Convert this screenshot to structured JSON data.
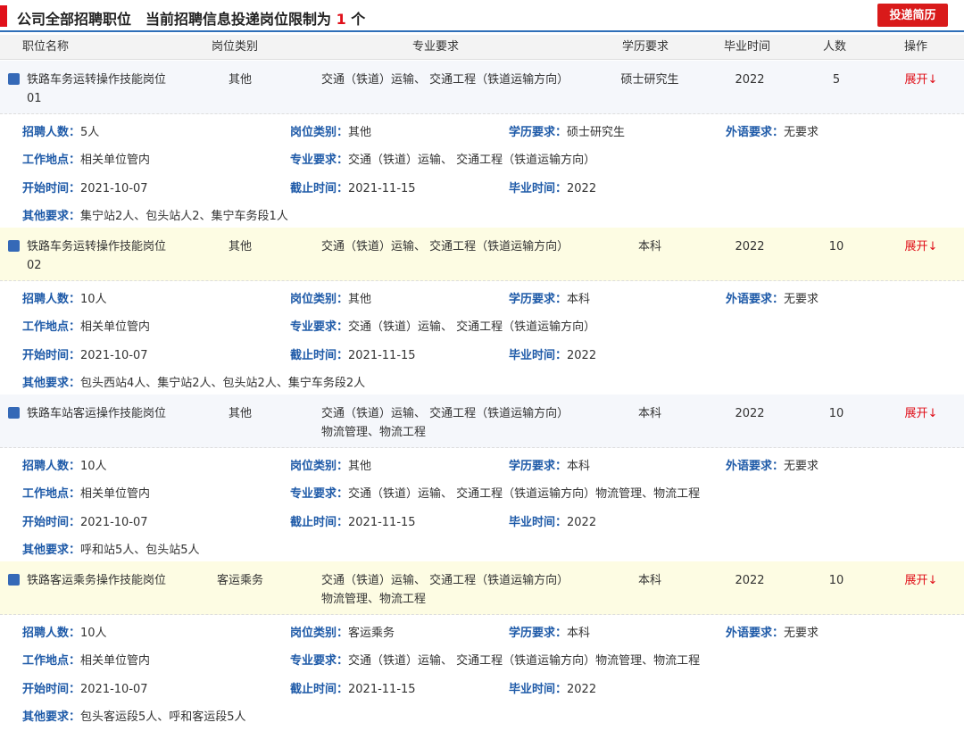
{
  "header": {
    "title_prefix": "公司全部招聘职位　当前招聘信息投递岗位限制为 ",
    "limit_count": "1",
    "title_suffix": " 个",
    "submit_label": "投递简历",
    "accent_color": "#e0101a",
    "brand_blue": "#2f6fb8"
  },
  "columns": {
    "name": "职位名称",
    "type": "岗位类别",
    "major": "专业要求",
    "edu": "学历要求",
    "grad": "毕业时间",
    "num": "人数",
    "op": "操作"
  },
  "labels": {
    "count": "招聘人数：",
    "type": "岗位类别：",
    "edu": "学历要求：",
    "lang": "外语要求：",
    "location": "工作地点：",
    "major": "专业要求：",
    "start": "开始时间：",
    "end": "截止时间：",
    "grad": "毕业时间：",
    "other": "其他要求："
  },
  "jobs": [
    {
      "title": "铁路车务运转操作技能岗位01",
      "type": "其他",
      "major": "交通（铁道）运输、 交通工程（铁道运输方向）",
      "edu": "硕士研究生",
      "grad": "2022",
      "num": "5",
      "op": "展开↓",
      "count": "5人",
      "lang": "无要求",
      "location": "相关单位管内",
      "major_detail": "交通（铁道）运输、 交通工程（铁道运输方向）",
      "start": "2021-10-07",
      "end": "2021-11-15",
      "other": "集宁站2人、包头站人2、集宁车务段1人"
    },
    {
      "title": "铁路车务运转操作技能岗位02",
      "type": "其他",
      "major": "交通（铁道）运输、 交通工程（铁道运输方向）",
      "edu": "本科",
      "grad": "2022",
      "num": "10",
      "op": "展开↓",
      "count": "10人",
      "lang": "无要求",
      "location": "相关单位管内",
      "major_detail": "交通（铁道）运输、 交通工程（铁道运输方向）",
      "start": "2021-10-07",
      "end": "2021-11-15",
      "other": "包头西站4人、集宁站2人、包头站2人、集宁车务段2人"
    },
    {
      "title": "铁路车站客运操作技能岗位",
      "type": "其他",
      "major": "交通（铁道）运输、 交通工程（铁道运输方向）物流管理、物流工程",
      "edu": "本科",
      "grad": "2022",
      "num": "10",
      "op": "展开↓",
      "count": "10人",
      "lang": "无要求",
      "location": "相关单位管内",
      "major_detail": "交通（铁道）运输、 交通工程（铁道运输方向）物流管理、物流工程",
      "start": "2021-10-07",
      "end": "2021-11-15",
      "other": "呼和站5人、包头站5人"
    },
    {
      "title": "铁路客运乘务操作技能岗位",
      "type": "客运乘务",
      "major": "交通（铁道）运输、 交通工程（铁道运输方向）物流管理、物流工程",
      "edu": "本科",
      "grad": "2022",
      "num": "10",
      "op": "展开↓",
      "count": "10人",
      "lang": "无要求",
      "location": "相关单位管内",
      "major_detail": "交通（铁道）运输、 交通工程（铁道运输方向）物流管理、物流工程",
      "start": "2021-10-07",
      "end": "2021-11-15",
      "other": "包头客运段5人、呼和客运段5人"
    }
  ]
}
